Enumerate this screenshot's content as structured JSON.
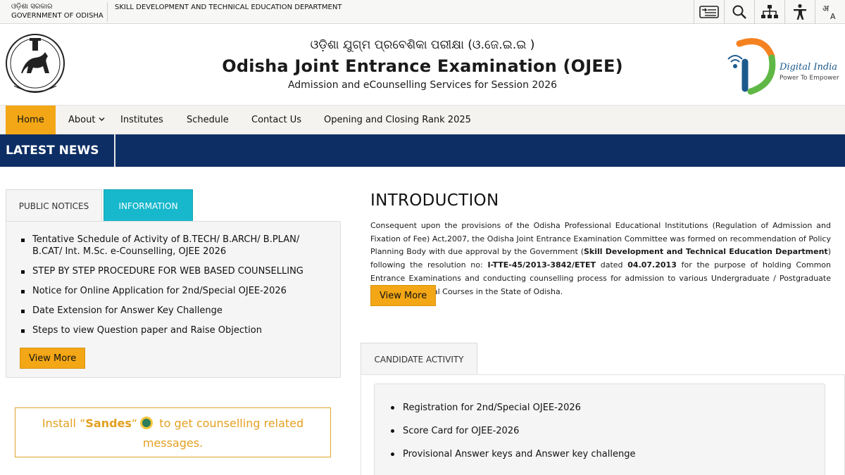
{
  "topbar": {
    "gov_odia": "ଓଡ଼ିଶା ସରକାର",
    "gov_en": "GOVERNMENT OF ODISHA",
    "department": "SKILL DEVELOPMENT AND TECHNICAL EDUCATION DEPARTMENT",
    "tools": [
      "skip-to-content-icon",
      "search-icon",
      "sitemap-icon",
      "accessibility-icon",
      "language-icon"
    ]
  },
  "header": {
    "odia_title": "ଓଡ଼ିଶା ଯୁଗ୍ମ ପ୍ରବେଶିକା ପରୀକ୍ଷା (ଓ.ଜେ.ଇ.ଇ )",
    "title": "Odisha Joint Entrance Examination (OJEE)",
    "subtitle": "Admission and eCounselling Services for Session 2026",
    "emblem_text": "ଓଡ଼ିଶା ଶାସନ",
    "digital_india": "Digital India",
    "digital_tagline": "Power To Empower"
  },
  "nav": {
    "items": [
      "Home",
      "About",
      "Institutes",
      "Schedule",
      "Contact Us",
      "Opening and Closing Rank 2025"
    ],
    "active": "Home"
  },
  "news": {
    "label": "LATEST NEWS"
  },
  "notices": {
    "tabs": [
      "PUBLIC NOTICES",
      "INFORMATION"
    ],
    "active_tab": "INFORMATION",
    "items": [
      "Tentative Schedule of Activity of B.TECH/ B.ARCH/ B.PLAN/ B.CAT/ Int. M.Sc. e-Counselling, OJEE 2026",
      "STEP BY STEP PROCEDURE FOR WEB BASED COUNSELLING",
      "Notice for Online Application for 2nd/Special OJEE-2026",
      "Date Extension for Answer Key Challenge",
      "Steps to view Question paper and Raise Objection"
    ],
    "view_more": "View More"
  },
  "sandes": {
    "prefix": "Install “",
    "app": "Sandes",
    "mid": "“",
    "suffix": " to get counselling related messages."
  },
  "intro": {
    "title": "INTRODUCTION",
    "p1": "Consequent upon the provisions of the Odisha Professional Educational Institutions (Regulation of Admission and Fixation of Fee) Act,2007, the Odisha Joint Entrance Examination Committee was formed on recommendation of Policy Planning Body with due approval by the Government (",
    "dept": "Skill Development and Technical Education Department",
    "p2": ") following the resolution no: ",
    "resolution": "I-TTE-45/2013-3842/ETET",
    "p3": " dated ",
    "date": "04.07.2013",
    "p4": " for the purpose of holding Common Entrance Examinations and conducting counselling process for admission to various Undergraduate / Postgraduate Level Professional Courses in the State of Odisha.",
    "view_more": "View More"
  },
  "candidate": {
    "tab": "CANDIDATE ACTIVITY",
    "items": [
      "Registration for 2nd/Special OJEE-2026",
      "Score Card for OJEE-2026",
      "Provisional Answer keys and Answer key challenge"
    ]
  },
  "colors": {
    "accent": "#f3a716",
    "news_bar": "#0d2e64",
    "info_tab": "#17b8cc"
  }
}
